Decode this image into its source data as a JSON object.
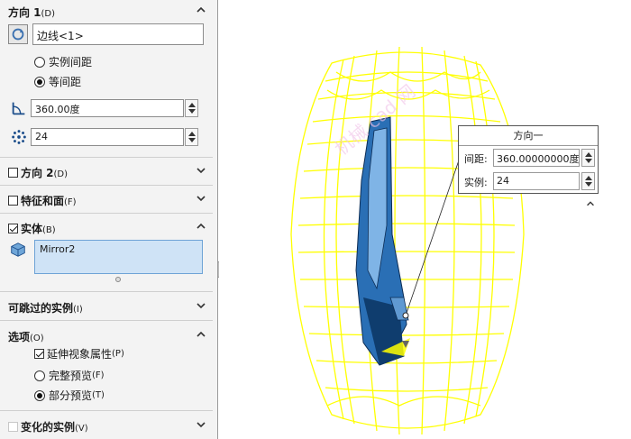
{
  "direction1": {
    "title": "方向 1",
    "hotkey": "(D)",
    "edge_field": "边线<1>",
    "radio_instance_spacing": "实例间距",
    "radio_equal_spacing": "等间距",
    "radio_selected": "等间距",
    "angle_value": "360.00度",
    "count_value": "24"
  },
  "direction2": {
    "title": "方向 2",
    "hotkey": "(D)",
    "checked": false
  },
  "features_faces": {
    "title": "特征和面",
    "hotkey": "(F)",
    "checked": false
  },
  "bodies": {
    "title": "实体",
    "hotkey": "(B)",
    "checked": true,
    "list_items": [
      "Mirror2"
    ]
  },
  "skip_instances": {
    "title": "可跳过的实例",
    "hotkey": "(I)"
  },
  "options": {
    "title": "选项",
    "hotkey": "(O)",
    "propagate_label": "延伸视象属性",
    "propagate_hotkey": "(P)",
    "propagate_checked": true,
    "full_preview_label": "完整预览",
    "full_preview_hotkey": "(F)",
    "partial_preview_label": "部分预览",
    "partial_preview_hotkey": "(T)",
    "preview_selected": "部分预览"
  },
  "varying_instances": {
    "title": "变化的实例",
    "hotkey": "(V)",
    "checked": false
  },
  "callout": {
    "title": "方向一",
    "spacing_label": "间距:",
    "spacing_value": "360.00000000度",
    "instances_label": "实例:",
    "instances_value": "24"
  },
  "colors": {
    "wireframe": "#ffff00",
    "selected_body": "#2a6fb5",
    "accent": "#1f1f1f"
  }
}
